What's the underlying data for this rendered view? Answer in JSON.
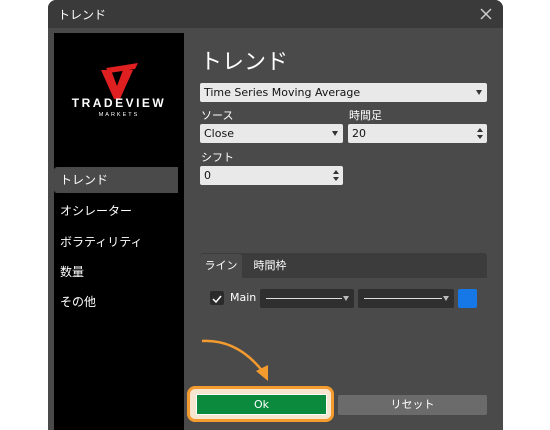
{
  "window": {
    "title": "トレンド"
  },
  "sidebar": {
    "logo": {
      "brand": "TRADEVIEW",
      "subtitle": "MARKETS"
    },
    "items": [
      {
        "label": "トレンド",
        "active": true
      },
      {
        "label": "オシレーター",
        "active": false
      },
      {
        "label": "ボラティリティ",
        "active": false
      },
      {
        "label": "数量",
        "active": false
      },
      {
        "label": "その他",
        "active": false
      }
    ]
  },
  "main": {
    "heading": "トレンド",
    "indicator_select": {
      "value": "Time Series Moving Average"
    },
    "source": {
      "label": "ソース",
      "value": "Close"
    },
    "timeframe": {
      "label": "時間足",
      "value": "20"
    },
    "shift": {
      "label": "シフト",
      "value": "0"
    },
    "tabs": [
      {
        "label": "ライン",
        "active": true
      },
      {
        "label": "時間枠",
        "active": false
      }
    ],
    "line_row": {
      "checked": true,
      "label": "Main",
      "color": "#1677e6"
    }
  },
  "footer": {
    "ok_label": "Ok",
    "reset_label": "リセット"
  },
  "colors": {
    "highlight": "#f39b2f",
    "ok_green": "#0b8a3e",
    "logo_red": "#e02020"
  }
}
